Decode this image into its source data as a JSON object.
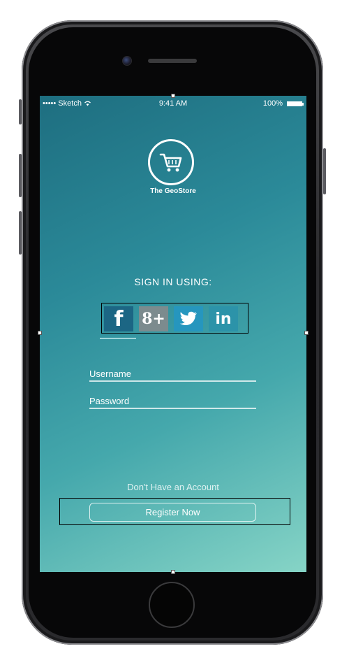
{
  "status_bar": {
    "carrier": "••••• Sketch",
    "time": "9:41 AM",
    "battery": "100%"
  },
  "brand": {
    "name": "The GeoStore"
  },
  "signin": {
    "title": "SIGN IN USING:"
  },
  "social": {
    "facebook": "f",
    "google": "8+",
    "linkedin": "in"
  },
  "form": {
    "username_label": "Username",
    "password_label": "Password"
  },
  "register": {
    "prompt": "Don't Have an Account",
    "button": "Register Now"
  },
  "colors": {
    "screen_gradient_start": "#1e6e80",
    "screen_gradient_end": "#86d4c6",
    "facebook": "#1c6684",
    "google": "#7c8b8e",
    "twitter": "#2696be",
    "linkedin": "#2c93a9"
  }
}
